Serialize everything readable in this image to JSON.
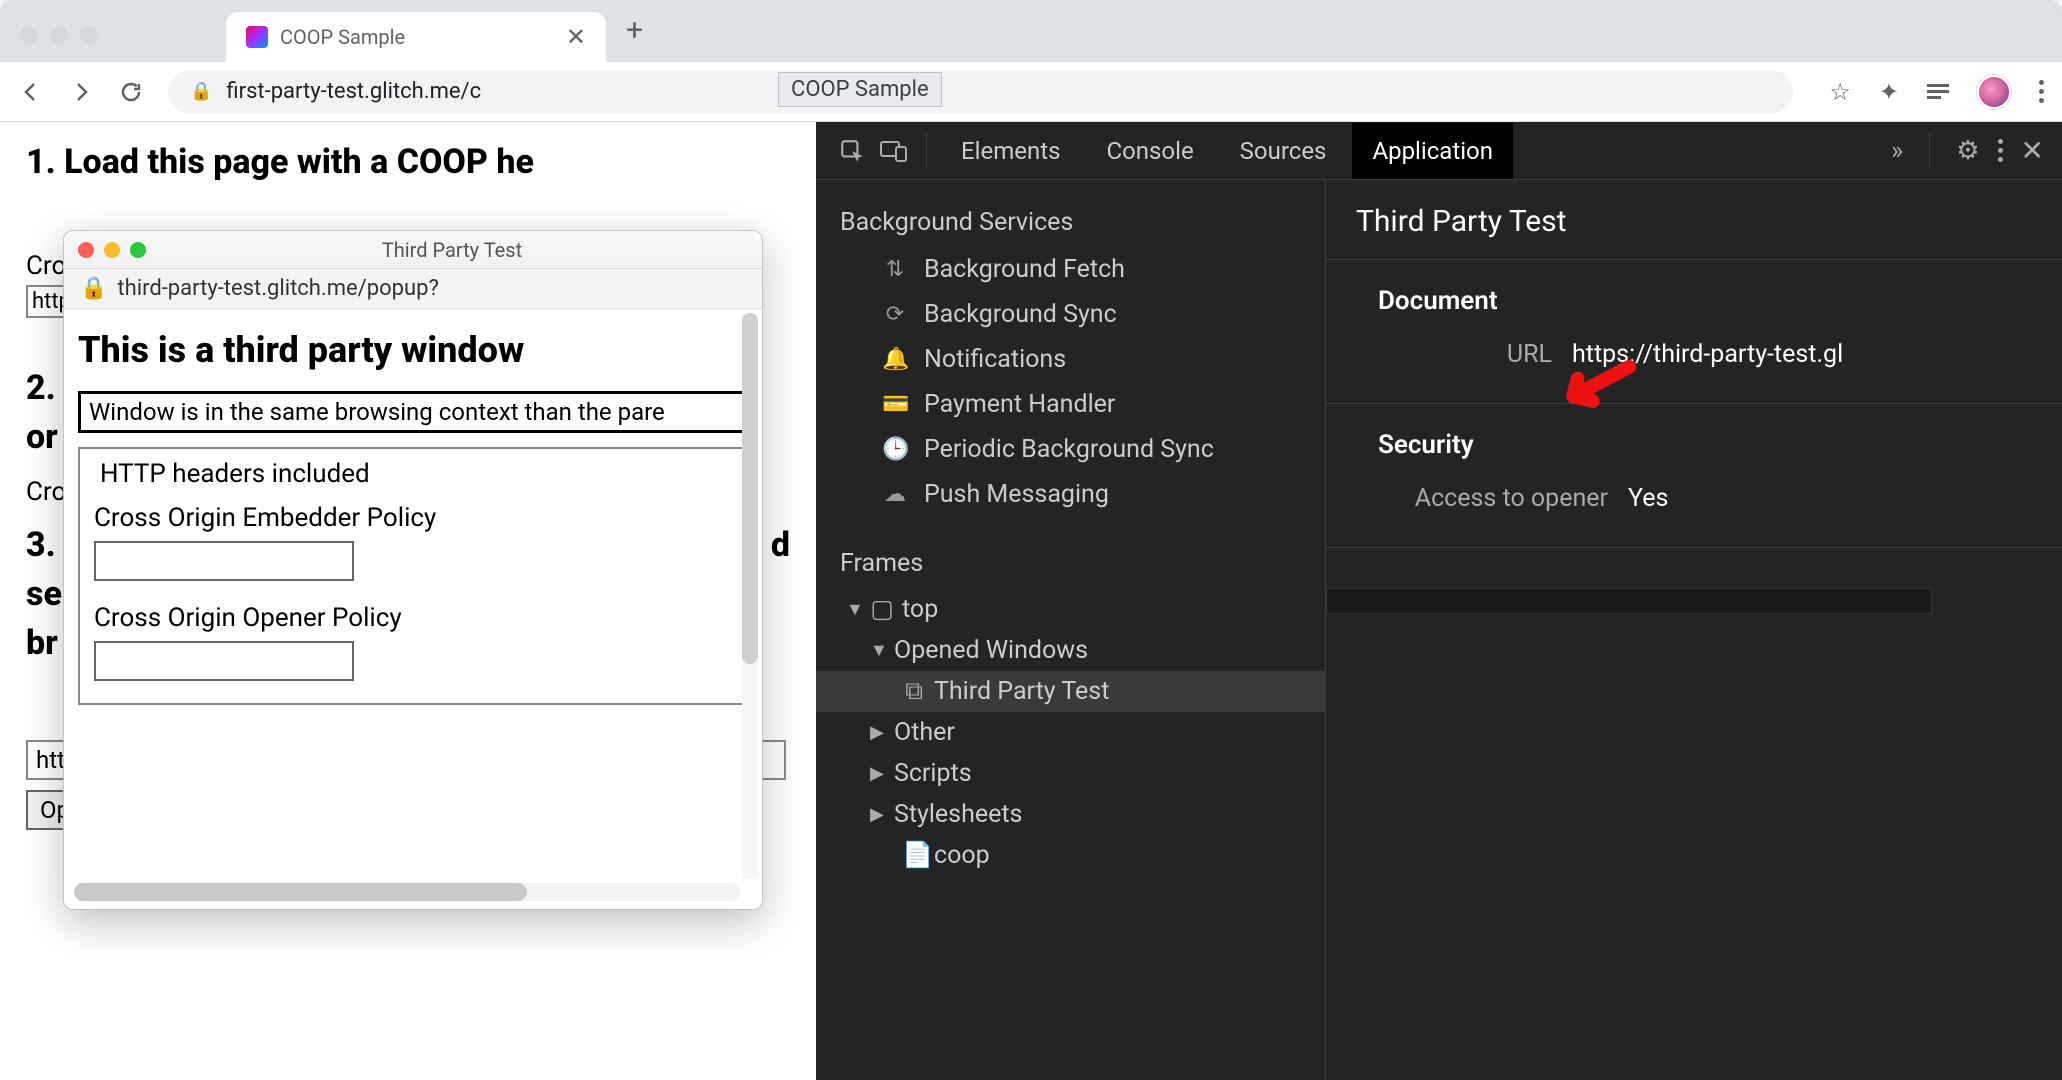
{
  "browser": {
    "tab_title": "COOP Sample",
    "url": "first-party-test.glitch.me/c",
    "title_tooltip": "COOP Sample"
  },
  "page": {
    "h1": "1. Load this page with a COOP he",
    "label_cro": "Cro",
    "http_text": "http",
    "h2_prefix": "2.",
    "h2_rest": "or",
    "label_cro2": "Cro",
    "h3_prefix": "3.",
    "h3_l2": "se",
    "h3_l3": "br",
    "h2_between": "d",
    "url_input": "https://third-party-test.glitch.me/popup?",
    "open_btn": "Open a popup"
  },
  "popup": {
    "title": "Third Party Test",
    "url": "third-party-test.glitch.me/popup?",
    "heading": "This is a third party window",
    "status": "Window is in the same browsing context than the pare",
    "fieldset_legend": "HTTP headers included",
    "coep_label": "Cross Origin Embedder Policy",
    "coop_label": "Cross Origin Opener Policy"
  },
  "devtools": {
    "tabs": {
      "elements": "Elements",
      "console": "Console",
      "sources": "Sources",
      "application": "Application"
    },
    "sidebar": {
      "bg_services": "Background Services",
      "items": {
        "bg_fetch": "Background Fetch",
        "bg_sync": "Background Sync",
        "notifications": "Notifications",
        "payment": "Payment Handler",
        "periodic": "Periodic Background Sync",
        "push": "Push Messaging"
      },
      "frames": "Frames",
      "top": "top",
      "opened_windows": "Opened Windows",
      "third_party": "Third Party Test",
      "other": "Other",
      "scripts": "Scripts",
      "stylesheets": "Stylesheets",
      "coop": "coop"
    },
    "main": {
      "title": "Third Party Test",
      "doc_section": "Document",
      "url_label": "URL",
      "url_value": "https://third-party-test.gl",
      "sec_section": "Security",
      "opener_label": "Access to opener",
      "opener_value": "Yes"
    }
  }
}
